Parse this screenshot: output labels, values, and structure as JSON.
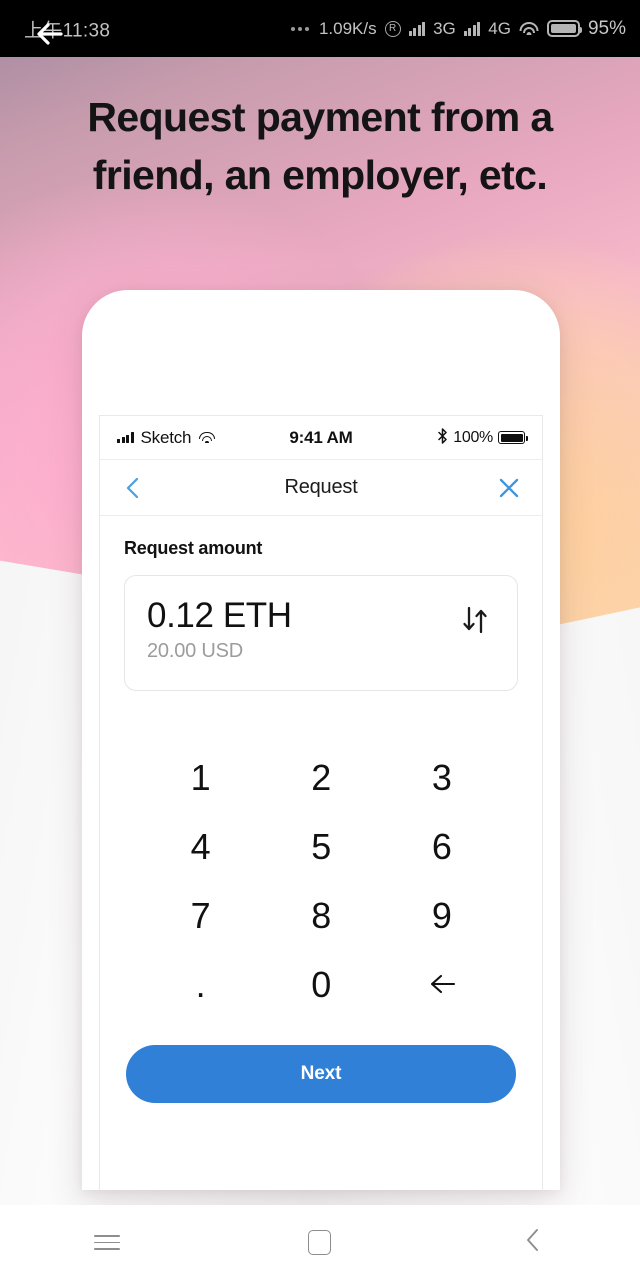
{
  "system_status_bar": {
    "time": "上午11:38",
    "network_speed": "1.09K/s",
    "roaming_icon": "R",
    "signal_1_label": "3G",
    "signal_2_label": "4G",
    "battery_percent": "95%",
    "icons": [
      "overflow-dots-icon",
      "roaming-icon",
      "signal-bars-icon",
      "wifi-icon",
      "battery-icon"
    ]
  },
  "hero": {
    "back_icon": "back-arrow-icon",
    "headline": "Request payment from a friend, an employer, etc.",
    "gradient_from": "#f7b8cb",
    "gradient_to": "#eec98e"
  },
  "phone": {
    "ios_status": {
      "carrier": "Sketch",
      "time": "9:41 AM",
      "battery_percent": "100%",
      "bluetooth_glyph": "✻",
      "icons": [
        "cellular-bars-icon",
        "wifi-icon",
        "bluetooth-icon",
        "battery-icon"
      ]
    },
    "app_nav": {
      "back_icon": "chevron-left-icon",
      "title": "Request",
      "close_icon": "close-x-icon",
      "accent_color": "#4a9fe0"
    },
    "amount": {
      "label": "Request amount",
      "primary_value": "0.12 ETH",
      "secondary_value": "20.00 USD",
      "swap_icon": "swap-arrows-icon"
    },
    "keypad": {
      "keys": [
        {
          "label": "1",
          "name": "key-1"
        },
        {
          "label": "2",
          "name": "key-2"
        },
        {
          "label": "3",
          "name": "key-3"
        },
        {
          "label": "4",
          "name": "key-4"
        },
        {
          "label": "5",
          "name": "key-5"
        },
        {
          "label": "6",
          "name": "key-6"
        },
        {
          "label": "7",
          "name": "key-7"
        },
        {
          "label": "8",
          "name": "key-8"
        },
        {
          "label": "9",
          "name": "key-9"
        },
        {
          "label": ".",
          "name": "key-decimal"
        },
        {
          "label": "0",
          "name": "key-0"
        },
        {
          "label": "",
          "name": "key-backspace"
        }
      ],
      "backspace_icon": "backspace-arrow-icon"
    },
    "next_button": {
      "label": "Next",
      "color": "#2f80d6"
    }
  },
  "android_nav": {
    "recents_icon": "menu-hamburger-icon",
    "home_icon": "home-square-icon",
    "back_icon": "chevron-left-icon"
  }
}
